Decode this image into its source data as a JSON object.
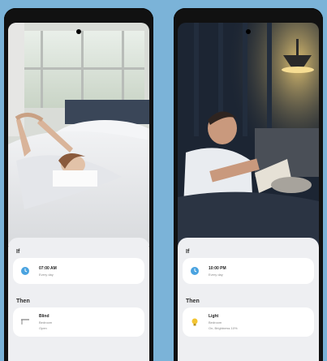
{
  "left_phone": {
    "if_label": "If",
    "then_label": "Then",
    "condition": {
      "title": "07:00 AM",
      "subtitle": "Every day",
      "icon": "clock-icon"
    },
    "action": {
      "title": "Blind",
      "subtitle": "Bedroom",
      "detail": "Open",
      "icon": "blind-icon"
    }
  },
  "right_phone": {
    "if_label": "If",
    "then_label": "Then",
    "condition": {
      "title": "10:00 PM",
      "subtitle": "Every day",
      "icon": "clock-icon"
    },
    "action": {
      "title": "Light",
      "subtitle": "Bedroom",
      "detail": "On, Brightness 10%",
      "icon": "bulb-icon"
    }
  },
  "colors": {
    "background": "#7bb3d8",
    "panel": "#eeeff2",
    "clock_blue": "#4aa3e0",
    "bulb_yellow": "#f3c532"
  }
}
